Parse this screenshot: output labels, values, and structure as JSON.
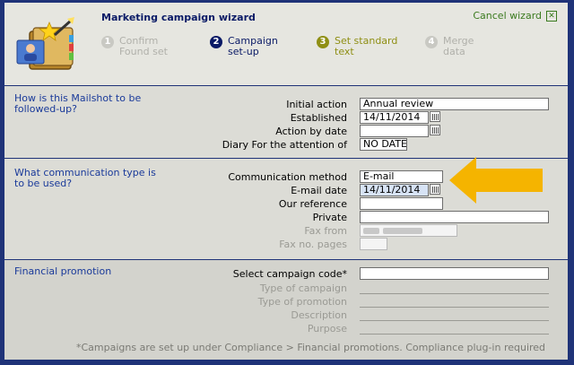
{
  "wizard": {
    "title": "Marketing campaign wizard",
    "cancel_label": "Cancel wizard",
    "steps": [
      {
        "num": "1",
        "line1": "Confirm",
        "line2": "Found set",
        "state": "done"
      },
      {
        "num": "2",
        "line1": "Campaign",
        "line2": "set-up",
        "state": "current"
      },
      {
        "num": "3",
        "line1": "Set standard",
        "line2": "text",
        "state": "next"
      },
      {
        "num": "4",
        "line1": "Merge",
        "line2": "data",
        "state": "future"
      }
    ]
  },
  "followup": {
    "title": "How is this Mailshot to be followed-up?",
    "initial_action_label": "Initial action",
    "initial_action_value": "Annual review",
    "established_label": "Established",
    "established_value": "14/11/2014",
    "action_by_label": "Action by date",
    "action_by_value": "",
    "diary_label": "Diary For the attention of",
    "diary_value": "NO DATE"
  },
  "communication": {
    "title": "What communication type is to be used?",
    "method_label": "Communication method",
    "method_value": "E-mail",
    "email_date_label": "E-mail date",
    "email_date_value": "14/11/2014",
    "our_ref_label": "Our reference",
    "our_ref_value": "",
    "private_label": "Private",
    "private_value": "",
    "fax_from_label": "Fax from",
    "fax_pages_label": "Fax no. pages"
  },
  "promotion": {
    "title": "Financial promotion",
    "select_code_label": "Select campaign code*",
    "select_code_value": "",
    "type_campaign_label": "Type of campaign",
    "type_promotion_label": "Type of promotion",
    "description_label": "Description",
    "purpose_label": "Purpose",
    "footnote": "*Campaigns are set up under Compliance > Financial promotions.  Compliance plug-in required"
  },
  "colors": {
    "accent_arrow": "#f5b400",
    "frame": "#1f3378",
    "current_step": "#0a1a66",
    "next_step": "#8f8f14",
    "section_title": "#1a3a9a"
  }
}
